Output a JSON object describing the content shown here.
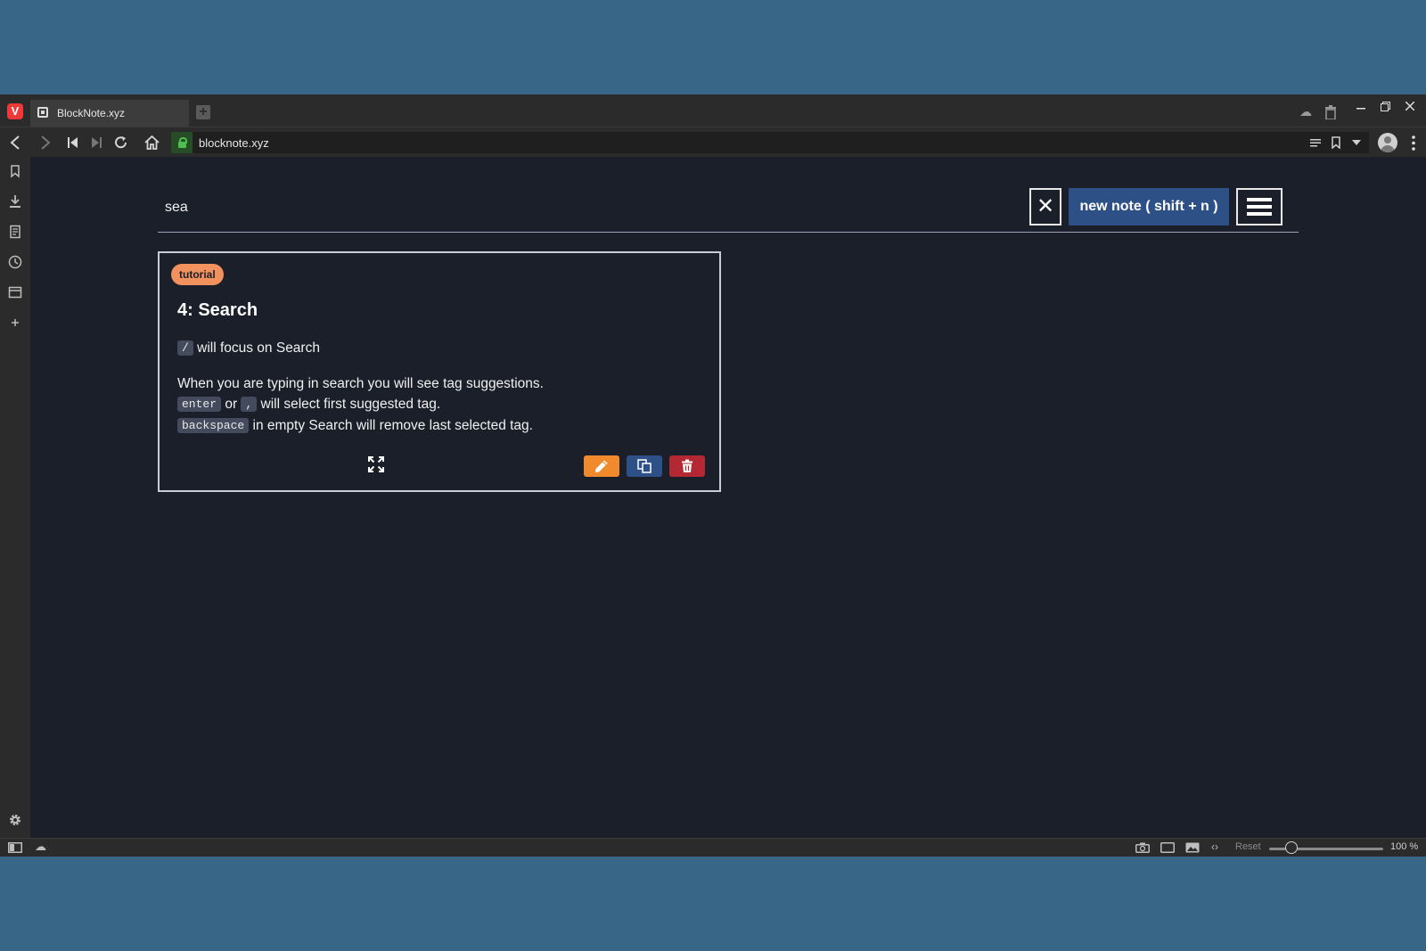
{
  "browser": {
    "tab_title": "BlockNote.xyz",
    "new_tab_symbol": "+",
    "logo_letter": "V",
    "url": "blocknote.xyz",
    "zoom_reset_label": "Reset",
    "zoom_level": "100 %"
  },
  "app": {
    "search": {
      "value": "sea",
      "clear_symbol": "✕"
    },
    "new_note_label": "new note ( shift + n )"
  },
  "note": {
    "tag": "tutorial",
    "title": "4: Search",
    "line1": {
      "key": "/",
      "text": " will focus on Search"
    },
    "line2": "When you are typing in search you will see tag suggestions.",
    "line3": {
      "key1": "enter",
      "between": " or ",
      "key2": ",",
      "text": " will select first suggested tag."
    },
    "line4": {
      "key": "backspace",
      "text": " in empty Search will remove last selected tag."
    }
  },
  "colors": {
    "background": "#386686",
    "page": "#1b1f2a",
    "tag": "#f0915e",
    "edit": "#f08a2c",
    "copy": "#2d5186",
    "delete": "#b32832"
  }
}
